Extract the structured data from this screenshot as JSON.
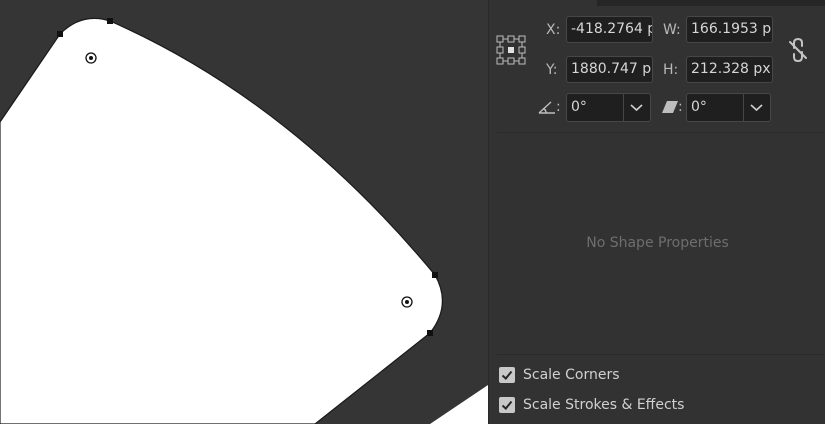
{
  "transform": {
    "x_label": "X:",
    "x_value": "-418.2764 p",
    "w_label": "W:",
    "w_value": "166.1953 p:",
    "y_label": "Y:",
    "y_value": "1880.747 p:",
    "h_label": "H:",
    "h_value": "212.328 px",
    "angle_label": ":",
    "angle_value": "0°",
    "shear_label": ":",
    "shear_value": "0°"
  },
  "shape_properties": {
    "message": "No Shape Properties"
  },
  "options": {
    "scale_corners_label": "Scale Corners",
    "scale_corners_checked": true,
    "scale_strokes_label": "Scale Strokes & Effects",
    "scale_strokes_checked": true
  },
  "icons": {
    "reference_point": "reference-point-icon",
    "constrain": "unlink-proportions-icon",
    "angle": "rotate-angle-icon",
    "shear": "shear-icon",
    "dropdown": "chevron-down-icon",
    "checkbox": "checkmark-icon"
  },
  "colors": {
    "canvas_bg": "#353535",
    "panel_bg": "#323232",
    "shape_fill": "#ffffff",
    "field_bg": "#1f1f1f"
  }
}
